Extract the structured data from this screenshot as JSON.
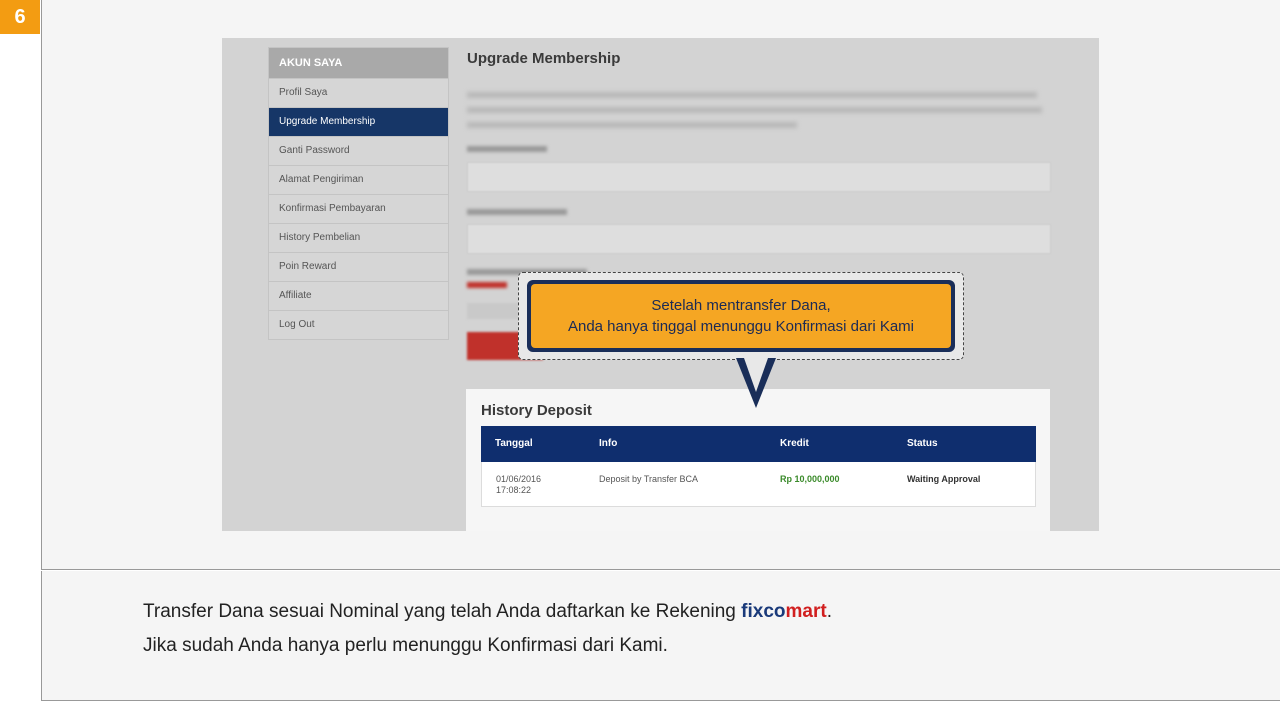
{
  "step_number": "6",
  "colors": {
    "step_badge": "#f39c12",
    "nav_active": "#163667",
    "table_header": "#0f2e6e",
    "callout_fill": "#f5a623",
    "callout_border": "#1a2e59",
    "brand_blue": "#1a3a7a",
    "brand_red": "#d11f1f",
    "amount_green": "#3a8a2a"
  },
  "sidebar": {
    "header": "AKUN SAYA",
    "items": [
      {
        "label": "Profil Saya",
        "active": false
      },
      {
        "label": "Upgrade Membership",
        "active": true
      },
      {
        "label": "Ganti Password",
        "active": false
      },
      {
        "label": "Alamat Pengiriman",
        "active": false
      },
      {
        "label": "Konfirmasi Pembayaran",
        "active": false
      },
      {
        "label": "History Pembelian",
        "active": false
      },
      {
        "label": "Poin Reward",
        "active": false
      },
      {
        "label": "Affiliate",
        "active": false
      },
      {
        "label": "Log Out",
        "active": false
      }
    ]
  },
  "main": {
    "title": "Upgrade Membership"
  },
  "history": {
    "title": "History Deposit",
    "columns": [
      "Tanggal",
      "Info",
      "Kredit",
      "Status"
    ],
    "rows": [
      {
        "date": "01/06/2016",
        "time": "17:08:22",
        "info": "Deposit by Transfer BCA",
        "kredit": "Rp 10,000,000",
        "status": "Waiting Approval"
      }
    ]
  },
  "callout": {
    "line1": "Setelah mentransfer Dana,",
    "line2": "Anda hanya tinggal menunggu Konfirmasi dari Kami"
  },
  "caption": {
    "line1_prefix": "Transfer Dana sesuai Nominal yang telah Anda daftarkan ke Rekening ",
    "brand_part1": "fixco",
    "brand_part2": "mart",
    "line1_suffix": ".",
    "line2": "Jika sudah Anda hanya perlu menunggu Konfirmasi dari Kami."
  }
}
